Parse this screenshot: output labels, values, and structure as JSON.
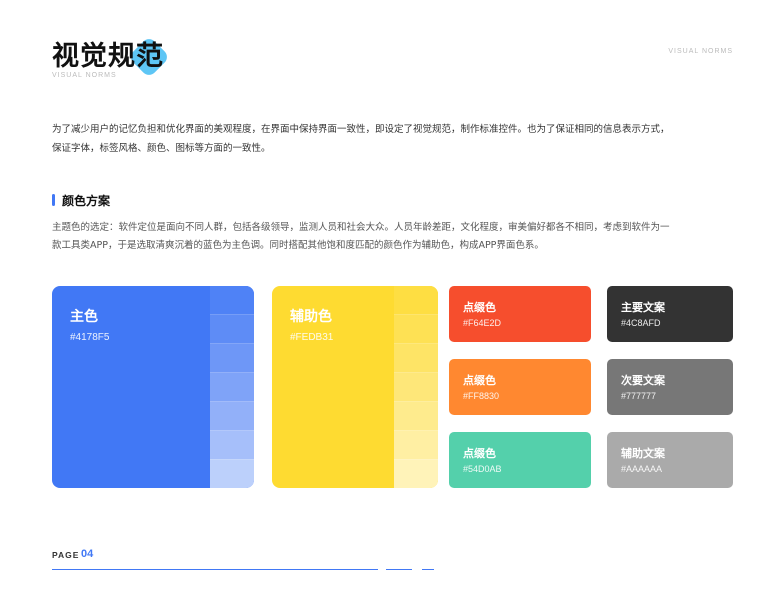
{
  "header": {
    "title": "视觉规范",
    "subtitle": "VISUAL NORMS",
    "corner_label": "VISUAL NORMS"
  },
  "intro": "为了减少用户的记忆负担和优化界面的美观程度，在界面中保持界面一致性，即设定了视觉规范，制作标准控件。也为了保证相同的信息表示方式，保证字体，标签风格、颜色、图标等方面的一致性。",
  "section": {
    "title": "颜色方案",
    "description": "主题色的选定：软件定位是面向不同人群，包括各级领导，监测人员和社会大众。人员年龄差距，文化程度，审美偏好都各不相同，考虑到软件为一款工具类APP，于是选取清爽沉着的蓝色为主色调。同时搭配其他饱和度匹配的颜色作为辅助色，构成APP界面色系。"
  },
  "primary": {
    "label": "主色",
    "hex": "#4178F5",
    "color": "#4178F5",
    "shades": [
      "#4f82f6",
      "#5e8cf6",
      "#6e97f7",
      "#7fa3f8",
      "#92b0f9",
      "#a6bffa",
      "#bcd0fb"
    ]
  },
  "secondary": {
    "label": "辅助色",
    "hex": "#FEDB31",
    "color": "#FEDB31",
    "shades": [
      "#fede42",
      "#fee154",
      "#fee466",
      "#fee779",
      "#feeb8d",
      "#ffefa3",
      "#fff3b9"
    ]
  },
  "accents": [
    {
      "label": "点缀色",
      "hex": "#F64E2D",
      "color": "#F64E2D"
    },
    {
      "label": "点缀色",
      "hex": "#FF8830",
      "color": "#FF8830"
    },
    {
      "label": "点缀色",
      "hex": "#54D0AB",
      "color": "#54D0AB"
    }
  ],
  "texts": [
    {
      "label": "主要文案",
      "hex": "#4C8AFD",
      "color": "#333333"
    },
    {
      "label": "次要文案",
      "hex": "#777777",
      "color": "#777777"
    },
    {
      "label": "辅助文案",
      "hex": "#AAAAAA",
      "color": "#AAAAAA"
    }
  ],
  "footer": {
    "page_label": "PAGE",
    "page_number": "04"
  }
}
